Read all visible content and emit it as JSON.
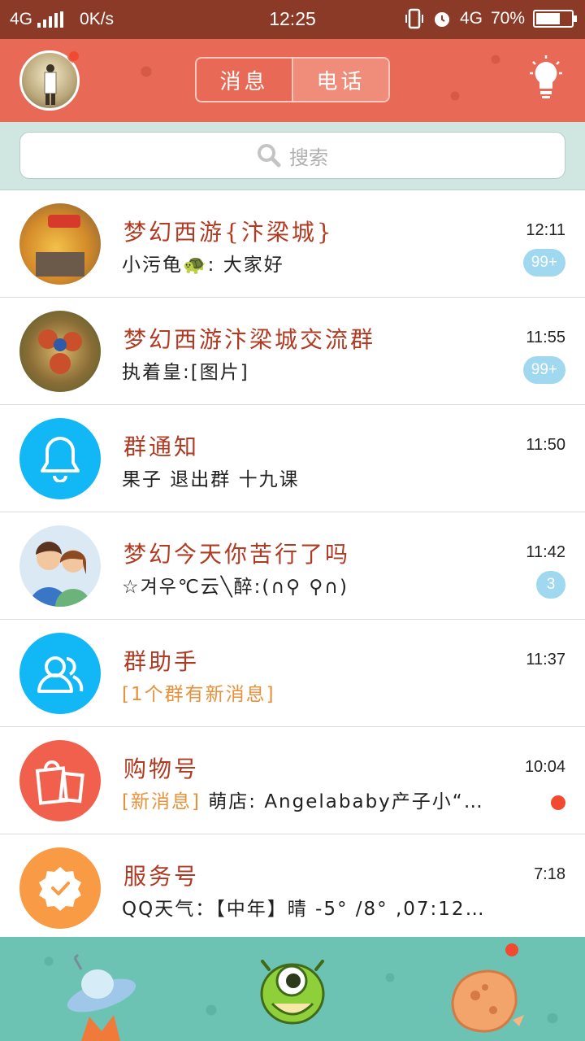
{
  "status_bar": {
    "network_left": "4G",
    "speed": "0K/s",
    "time": "12:25",
    "network_right": "4G",
    "battery": "70%",
    "battery_level": 0.7
  },
  "header": {
    "tabs": [
      {
        "label": "消息",
        "active": false
      },
      {
        "label": "电话",
        "active": true
      }
    ],
    "avatar_has_notification": true
  },
  "search": {
    "placeholder": "搜索"
  },
  "conversations": [
    {
      "name": "梦幻西游{汴梁城}",
      "preview": "小污龟🐢: 大家好",
      "highlight": "",
      "time": "12:11",
      "badge": "99+",
      "avatar": "game-group-avatar"
    },
    {
      "name": "梦幻西游汴梁城交流群",
      "preview": "执着皇:[图片]",
      "highlight": "",
      "time": "11:55",
      "badge": "99+",
      "avatar": "game-group-avatar"
    },
    {
      "name": "群通知",
      "preview": "果子 退出群 十九课",
      "highlight": "",
      "time": "11:50",
      "badge": "",
      "avatar": "bell-icon"
    },
    {
      "name": "梦幻今天你苦行了吗",
      "preview": "☆겨우℃云╲醉:(∩⚲ ⚲∩)",
      "highlight": "",
      "time": "11:42",
      "badge": "3",
      "avatar": "couple-avatar"
    },
    {
      "name": "群助手",
      "preview": "",
      "highlight": "[1个群有新消息]",
      "time": "11:37",
      "badge": "",
      "avatar": "group-helper-icon"
    },
    {
      "name": "购物号",
      "preview": "萌店: Angelababy产子小“…",
      "highlight": "[新消息]",
      "time": "10:04",
      "badge": "",
      "dot": true,
      "avatar": "shopping-bag-icon"
    },
    {
      "name": "服务号",
      "preview": "QQ天气：【中年】晴 -5° /8° ,07:12更…",
      "highlight": "",
      "time": "7:18",
      "badge": "",
      "avatar": "service-badge-icon"
    }
  ],
  "tabbar": {
    "items": [
      "ufo-icon",
      "monster-icon",
      "planet-icon"
    ],
    "planet_has_notification": true
  },
  "colors": {
    "header_bg": "#e86a56",
    "title_red": "#b03a22",
    "badge_blue": "#9fd8ef",
    "icon_blue": "#12b7f5",
    "tabbar_teal": "#6cc3b4"
  }
}
